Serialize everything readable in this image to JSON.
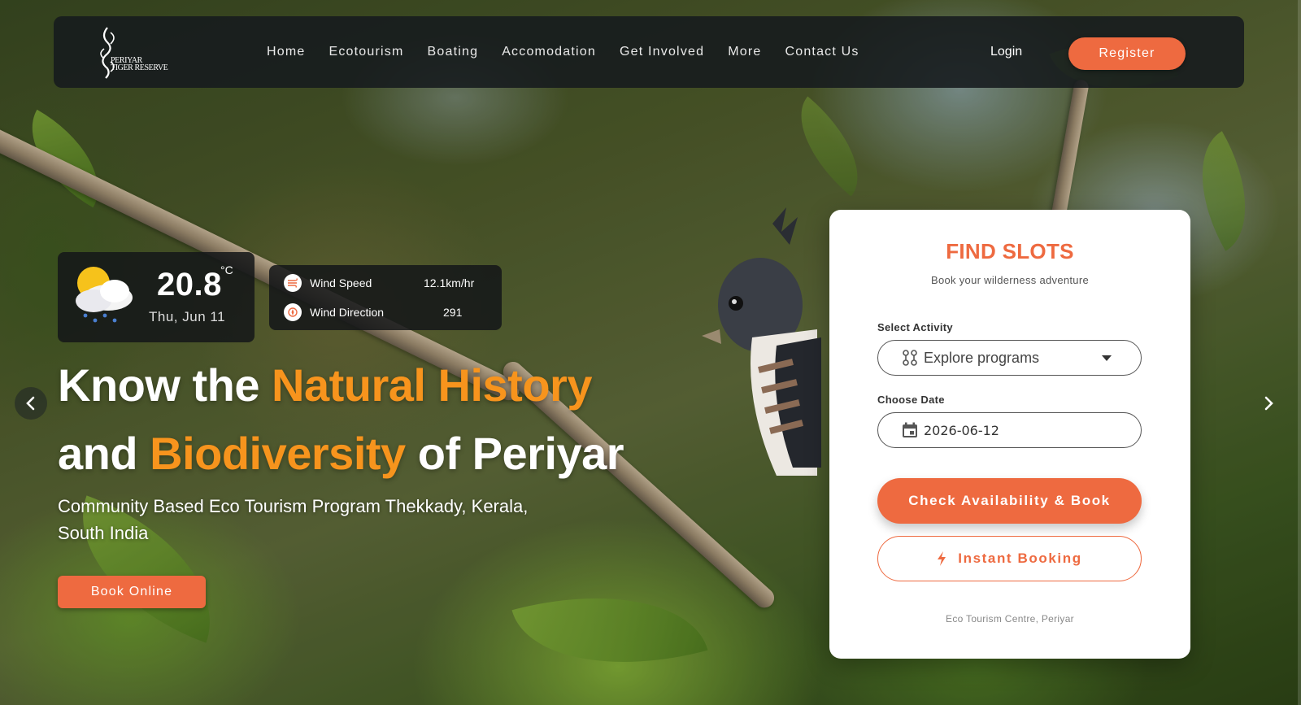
{
  "brand": {
    "logo_text_line1": "PERIYAR",
    "logo_text_line2": "TIGER RESERVE"
  },
  "nav": {
    "items": [
      {
        "label": "Home"
      },
      {
        "label": "Ecotourism"
      },
      {
        "label": "Boating"
      },
      {
        "label": "Accomodation"
      },
      {
        "label": "Get Involved"
      },
      {
        "label": "More"
      },
      {
        "label": "Contact Us"
      }
    ],
    "login_label": "Login",
    "register_label": "Register"
  },
  "weather": {
    "icon": "cloud-sun-rain-icon",
    "temperature": "20.8",
    "unit": "°C",
    "date": "Thu, Jun 11"
  },
  "wind": {
    "speed_label": "Wind Speed",
    "speed_value": "12.1km/hr",
    "speed_icon": "wind-icon",
    "direction_label": "Wind Direction",
    "direction_value": "291",
    "direction_icon": "compass-icon"
  },
  "hero": {
    "headline_part1": "Know the ",
    "headline_accent1": "Natural History",
    "headline_part2": "and ",
    "headline_accent2": "Biodiversity",
    "headline_part3": " of Periyar",
    "subtitle": "Community Based Eco Tourism Program Thekkady, Kerala, South India",
    "book_online_label": "Book Online"
  },
  "booking": {
    "title": "FIND SLOTS",
    "subtitle": "Book your wilderness adventure",
    "activity_label": "Select Activity",
    "activity_value": "Explore programs",
    "date_label": "Choose Date",
    "date_value": "2026-06-12",
    "check_button": "Check Availability & Book",
    "instant_button": "Instant Booking",
    "footer": "Eco Tourism Centre, Periyar"
  },
  "colors": {
    "accent": "#ee6a40",
    "highlight": "#f7941d",
    "title": "#ee6a40"
  }
}
